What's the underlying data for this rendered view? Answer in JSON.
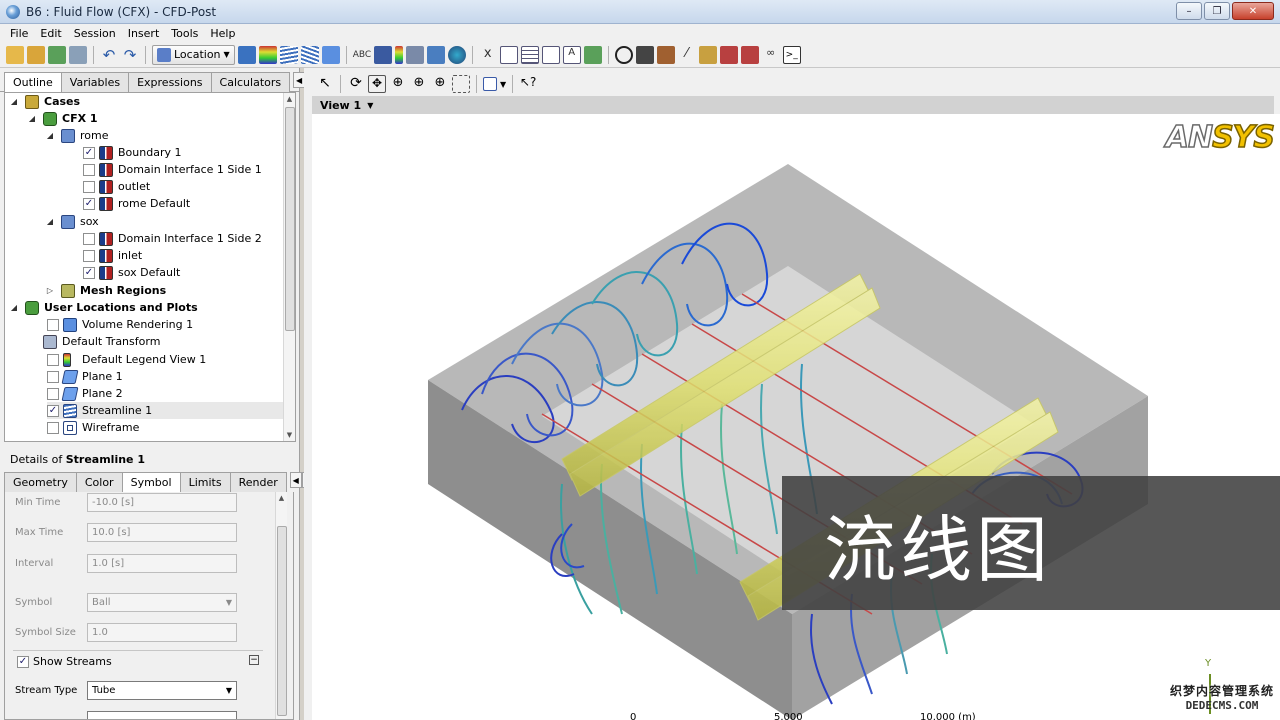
{
  "window": {
    "title": "B6 : Fluid Flow (CFX) - CFD-Post"
  },
  "menu": [
    "File",
    "Edit",
    "Session",
    "Insert",
    "Tools",
    "Help"
  ],
  "toolbar": {
    "location_label": "Location"
  },
  "left_tabs": [
    "Outline",
    "Variables",
    "Expressions",
    "Calculators"
  ],
  "outline": {
    "cases": "Cases",
    "cfx1": "CFX 1",
    "rome": "rome",
    "rome_items": [
      {
        "label": "Boundary 1",
        "checked": true
      },
      {
        "label": "Domain Interface 1 Side 1",
        "checked": false
      },
      {
        "label": "outlet",
        "checked": false
      },
      {
        "label": "rome Default",
        "checked": true
      }
    ],
    "sox": "sox",
    "sox_items": [
      {
        "label": "Domain Interface 1 Side 2",
        "checked": false
      },
      {
        "label": "inlet",
        "checked": false
      },
      {
        "label": "sox Default",
        "checked": true
      }
    ],
    "mesh_regions": "Mesh Regions",
    "user_locations": "User Locations and Plots",
    "user_items": [
      {
        "label": "Volume Rendering 1",
        "checked": false
      },
      {
        "label": "Default Transform"
      },
      {
        "label": "Default Legend View 1",
        "checked": false
      },
      {
        "label": "Plane 1",
        "checked": false
      },
      {
        "label": "Plane 2",
        "checked": false
      },
      {
        "label": "Streamline 1",
        "checked": true
      },
      {
        "label": "Wireframe",
        "checked": false
      }
    ]
  },
  "details": {
    "prefix": "Details of ",
    "object": "Streamline 1",
    "tabs": [
      "Geometry",
      "Color",
      "Symbol",
      "Limits",
      "Render"
    ],
    "fields": {
      "min_time_label": "Min Time",
      "min_time_value": "-10.0 [s]",
      "max_time_label": "Max Time",
      "max_time_value": "10.0 [s]",
      "interval_label": "Interval",
      "interval_value": "1.0 [s]",
      "symbol_label": "Symbol",
      "symbol_value": "Ball",
      "symbol_size_label": "Symbol Size",
      "symbol_size_value": "1.0",
      "show_streams_label": "Show Streams",
      "stream_type_label": "Stream Type",
      "stream_type_value": "Tube"
    }
  },
  "view": {
    "name": "View 1",
    "logo_an": "AN",
    "logo_sys": "SYS",
    "axis_y": "Y"
  },
  "scale": {
    "s0": "0",
    "s1": "5.000",
    "s2": "10.000 (m)"
  },
  "overlay": {
    "text": "流线图"
  },
  "watermark": {
    "line1": "织梦内容管理系统",
    "line2": "DEDECMS.COM"
  }
}
